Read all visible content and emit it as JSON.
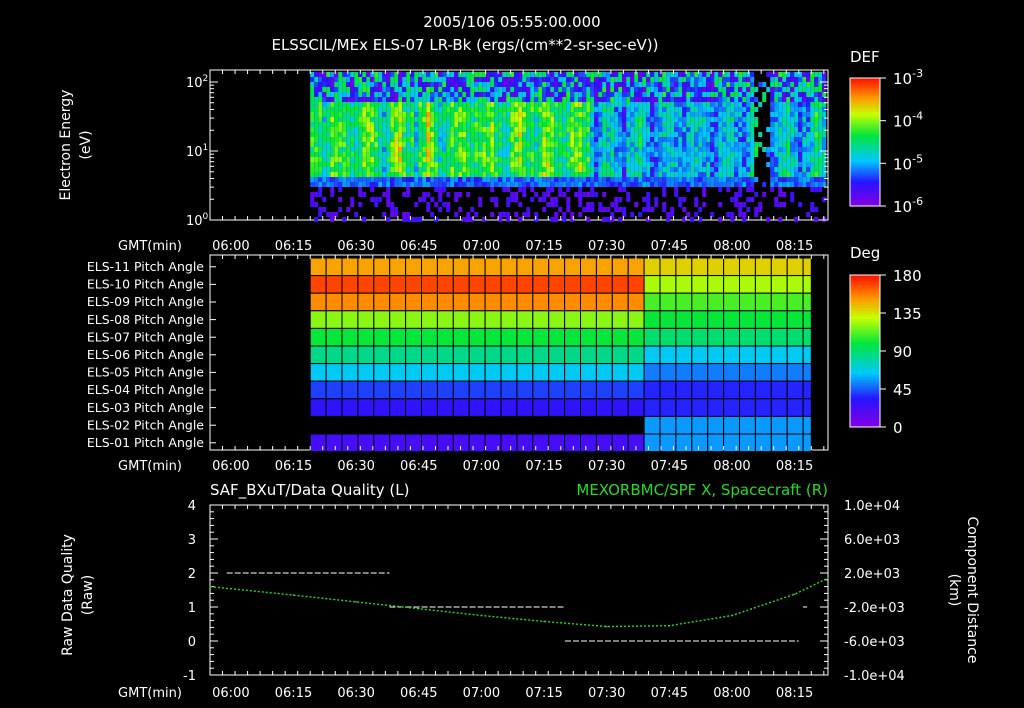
{
  "header": {
    "timestamp": "2005/106 05:55:00.000",
    "title": "ELSSCIL/MEx ELS-07 LR-Bk  (ergs/(cm**2-sr-sec-eV))"
  },
  "time_axis": {
    "label": "GMT(min)",
    "start": "05:55",
    "end": "08:23",
    "ticks": [
      "06:00",
      "06:15",
      "06:30",
      "06:45",
      "07:00",
      "07:15",
      "07:30",
      "07:45",
      "08:00",
      "08:15"
    ]
  },
  "chart_data": [
    {
      "type": "heatmap",
      "name": "spectrogram",
      "ylabel": "Electron Energy",
      "yunit": "(eV)",
      "yscale": "log",
      "ylim": [
        1,
        150
      ],
      "yticks": [
        {
          "base": "10",
          "exp": "0",
          "v": 1
        },
        {
          "base": "10",
          "exp": "1",
          "v": 10
        },
        {
          "base": "10",
          "exp": "2",
          "v": 100
        }
      ],
      "data_start": "06:19",
      "data_end": "08:22",
      "colorbar": {
        "title": "DEF",
        "scale": "log",
        "range": [
          1e-06,
          0.001
        ],
        "ticks": [
          {
            "base": "10",
            "exp": "-3",
            "v": -3
          },
          {
            "base": "10",
            "exp": "-4",
            "v": -4
          },
          {
            "base": "10",
            "exp": "-5",
            "v": -5
          },
          {
            "base": "10",
            "exp": "-6",
            "v": -6
          }
        ]
      }
    },
    {
      "type": "heatmap",
      "name": "pitch-angle",
      "rows": [
        "ELS-11 Pitch Angle",
        "ELS-10 Pitch Angle",
        "ELS-09 Pitch Angle",
        "ELS-08 Pitch Angle",
        "ELS-07 Pitch Angle",
        "ELS-06 Pitch Angle",
        "ELS-05 Pitch Angle",
        "ELS-04 Pitch Angle",
        "ELS-03 Pitch Angle",
        "ELS-02 Pitch Angle",
        "ELS-01 Pitch Angle"
      ],
      "data_start": "06:19",
      "transition": "07:37",
      "data_end": "08:19",
      "values_before_deg": [
        150,
        170,
        155,
        120,
        100,
        85,
        65,
        40,
        30,
        null,
        22
      ],
      "values_after_deg": [
        140,
        125,
        110,
        100,
        90,
        65,
        50,
        35,
        35,
        55,
        55
      ],
      "colorbar": {
        "title": "Deg",
        "range": [
          0,
          180
        ],
        "ticks": [
          "180",
          "135",
          "90",
          "45",
          "0"
        ]
      }
    },
    {
      "type": "line",
      "name": "quality-and-position",
      "title_left": "SAF_BXuT/Data Quality (L)",
      "title_right": "MEXORBMC/SPF X, Spacecraft (R)",
      "ylabel_left": "Raw Data Quality",
      "ylabel_left_unit": "(Raw)",
      "ylabel_right": "Component Distance",
      "ylabel_right_unit": "(km)",
      "ylim_left": [
        -1,
        4
      ],
      "yticks_left": [
        "4",
        "3",
        "2",
        "1",
        "0",
        "-1"
      ],
      "ylim_right": [
        -10000,
        10000
      ],
      "yticks_right": [
        "1.0e+04",
        "6.0e+03",
        "2.0e+03",
        "-2.0e+03",
        "-6.0e+03",
        "-1.0e+04"
      ],
      "quality_segments": [
        {
          "from": "05:59",
          "to": "06:38",
          "value": 2
        },
        {
          "from": "06:38",
          "to": "07:20",
          "value": 1
        },
        {
          "from": "07:20",
          "to": "08:16",
          "value": 0
        },
        {
          "from": "08:17",
          "to": "08:18",
          "value": 1
        }
      ],
      "spacecraft_x": {
        "color": "#22dd22",
        "times": [
          "05:55",
          "06:00",
          "06:15",
          "06:30",
          "06:45",
          "07:00",
          "07:15",
          "07:30",
          "07:45",
          "08:00",
          "08:15",
          "08:23"
        ],
        "values_km": [
          400,
          150,
          -600,
          -1400,
          -2200,
          -3000,
          -3700,
          -4300,
          -4200,
          -3000,
          -500,
          1400
        ]
      }
    }
  ]
}
